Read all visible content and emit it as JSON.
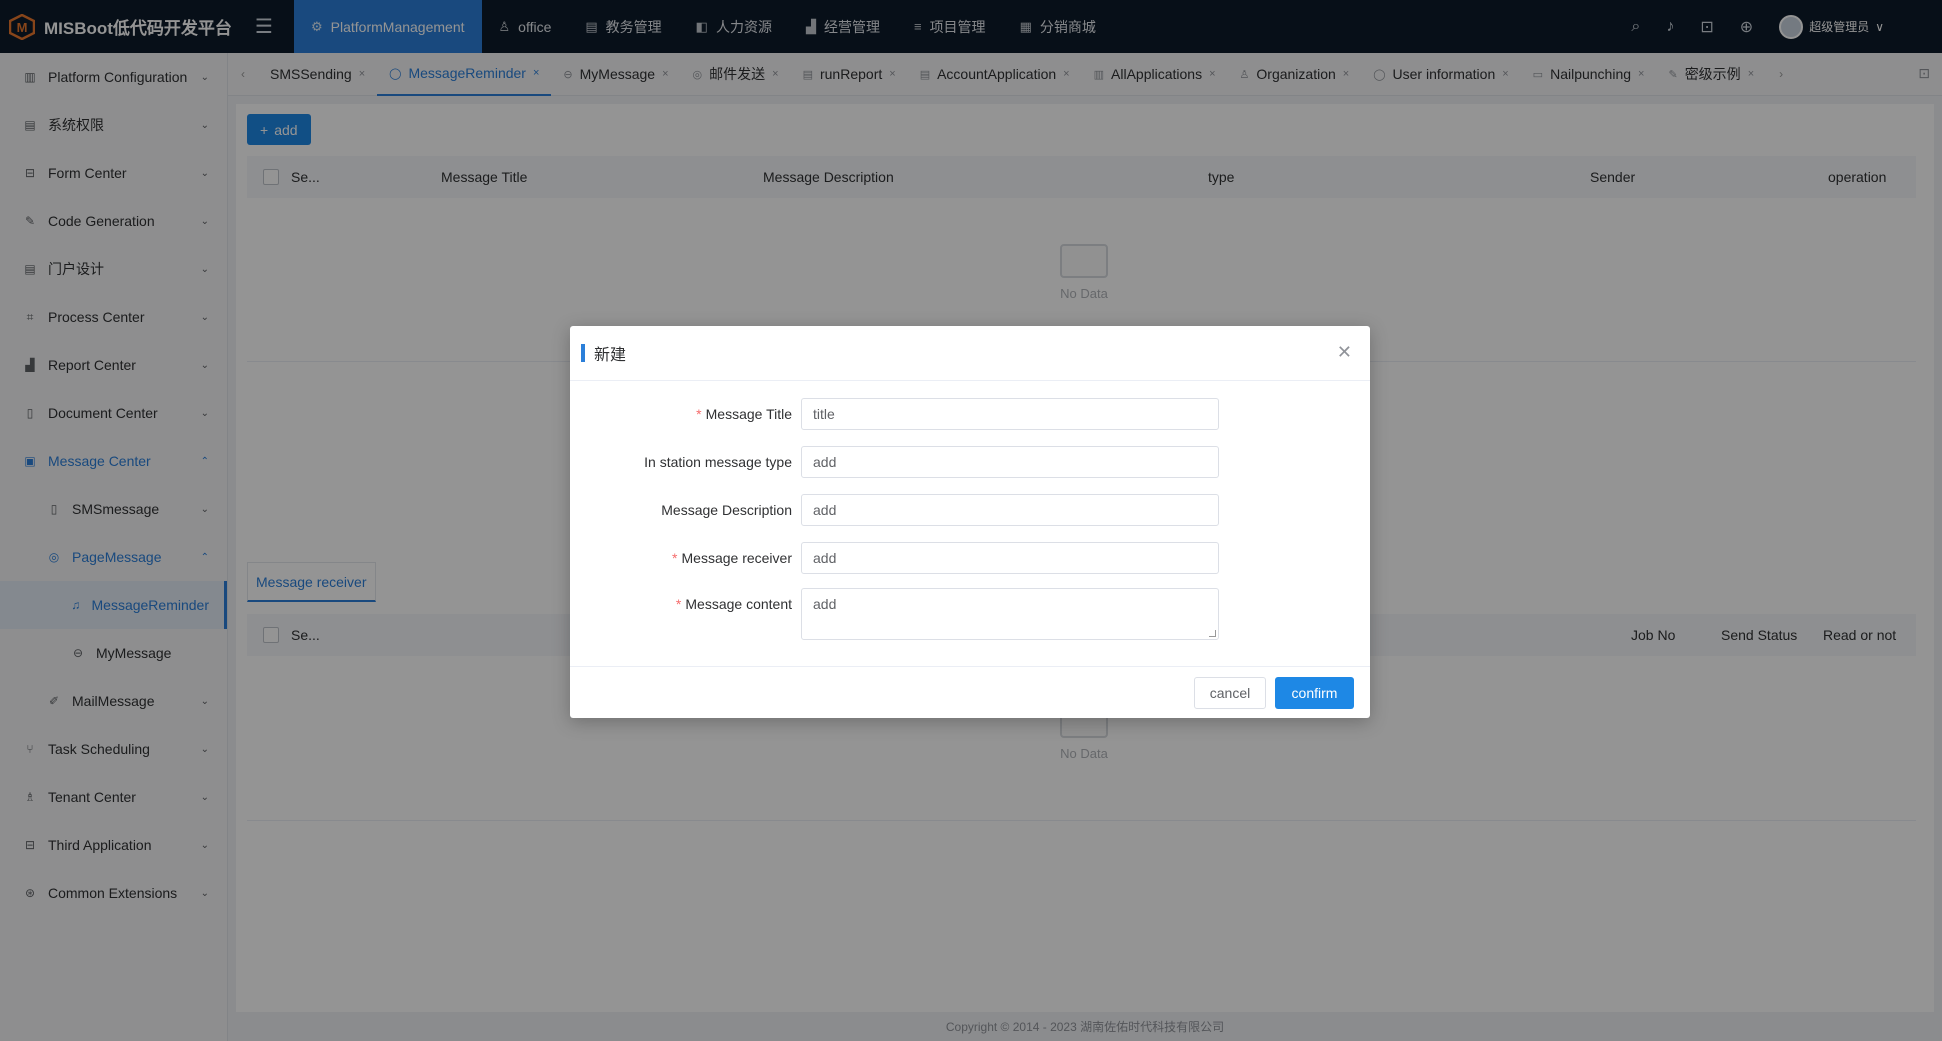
{
  "app": {
    "title": "MISBoot低代码开发平台"
  },
  "topnav": [
    {
      "label": "PlatformManagement",
      "icon": "gear-icon",
      "active": true
    },
    {
      "label": "office",
      "icon": "user-icon"
    },
    {
      "label": "教务管理",
      "icon": "book-icon"
    },
    {
      "label": "人力资源",
      "icon": "panel-icon"
    },
    {
      "label": "经营管理",
      "icon": "chart-icon"
    },
    {
      "label": "项目管理",
      "icon": "list-icon"
    },
    {
      "label": "分销商城",
      "icon": "shop-icon"
    }
  ],
  "user": {
    "name": "超级管理员"
  },
  "sidebar": {
    "items": [
      {
        "label": "Platform Configuration",
        "icon": "config-icon"
      },
      {
        "label": "系统权限",
        "icon": "permission-icon"
      },
      {
        "label": "Form Center",
        "icon": "form-icon"
      },
      {
        "label": "Code Generation",
        "icon": "code-icon"
      },
      {
        "label": "门户设计",
        "icon": "portal-icon"
      },
      {
        "label": "Process Center",
        "icon": "process-icon"
      },
      {
        "label": "Report Center",
        "icon": "report-icon"
      },
      {
        "label": "Document Center",
        "icon": "document-icon"
      },
      {
        "label": "Message Center",
        "icon": "message-icon"
      },
      {
        "label": "SMSmessage",
        "icon": "sms-icon"
      },
      {
        "label": "PageMessage",
        "icon": "page-message-icon"
      },
      {
        "label": "MessageReminder",
        "icon": "bell-icon"
      },
      {
        "label": "MyMessage",
        "icon": "chat-icon"
      },
      {
        "label": "MailMessage",
        "icon": "mail-icon"
      },
      {
        "label": "Task Scheduling",
        "icon": "schedule-icon"
      },
      {
        "label": "Tenant Center",
        "icon": "tenant-icon"
      },
      {
        "label": "Third Application",
        "icon": "app-icon"
      },
      {
        "label": "Common Extensions",
        "icon": "extension-icon"
      }
    ]
  },
  "tabs": [
    {
      "label": "SMSSending"
    },
    {
      "label": "MessageReminder",
      "active": true
    },
    {
      "label": "MyMessage"
    },
    {
      "label": "邮件发送"
    },
    {
      "label": "runReport"
    },
    {
      "label": "AccountApplication"
    },
    {
      "label": "AllApplications"
    },
    {
      "label": "Organization"
    },
    {
      "label": "User information"
    },
    {
      "label": "Nailpunching"
    },
    {
      "label": "密级示例"
    }
  ],
  "toolbar": {
    "add_label": "add"
  },
  "table1": {
    "columns": [
      "Se...",
      "Message Title",
      "Message Description",
      "type",
      "Sender",
      "operation"
    ],
    "empty_text": "No Data"
  },
  "subtab": {
    "label": "Message receiver"
  },
  "table2": {
    "columns": [
      "Se...",
      "Job No",
      "Send Status",
      "Read or not"
    ],
    "empty_text": "No Data"
  },
  "footer": {
    "copyright": "Copyright © 2014 - 2023 湖南佐佑时代科技有限公司"
  },
  "modal": {
    "title": "新建",
    "fields": [
      {
        "label": "Message Title",
        "required": true,
        "placeholder": "title"
      },
      {
        "label": "In station message type",
        "required": false,
        "placeholder": "add"
      },
      {
        "label": "Message Description",
        "required": false,
        "placeholder": "add"
      },
      {
        "label": "Message receiver",
        "required": true,
        "placeholder": "add"
      },
      {
        "label": "Message content",
        "required": true,
        "placeholder": "add"
      }
    ],
    "cancel_label": "cancel",
    "confirm_label": "confirm"
  },
  "colors": {
    "primary": "#1e88e5",
    "topbar": "#0d1b2a",
    "required": "#f56c6c"
  }
}
